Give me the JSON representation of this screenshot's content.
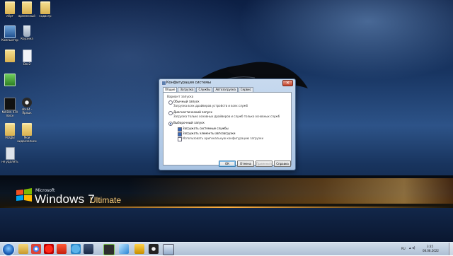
{
  "colors": {
    "accent": "#1a5db5",
    "dialog_frame": "#a9c3e2",
    "close_red": "#c5432a",
    "band_orange": "#ffb040"
  },
  "wallpaper": {
    "brand_small": "Microsoft",
    "brand_main": "Windows 7",
    "brand_edition": "Ultimate"
  },
  "desktop_icons": [
    {
      "label": "лёрт",
      "icon": "folder"
    },
    {
      "label": "временный",
      "icon": "folder"
    },
    {
      "label": "кадастр",
      "icon": "folder"
    },
    {
      "label": "Компьютер",
      "icon": "pc"
    },
    {
      "label": "Корзина",
      "icon": "trash"
    },
    {
      "label": "",
      "icon": "folder"
    },
    {
      "label": "Doc2",
      "icon": "doc"
    },
    {
      "label": "",
      "icon": "green"
    },
    {
      "label": "NVIDIA RTX Voice",
      "icon": "nv"
    },
    {
      "label": "obs64 - Ярлык",
      "icon": "obs"
    },
    {
      "label": "МОДЫ",
      "icon": "folder"
    },
    {
      "label": "Мои видеозаписи",
      "icon": "folder"
    },
    {
      "label": "не удалять",
      "icon": "blank"
    }
  ],
  "dialog": {
    "title": "Конфигурация системы",
    "close_glyph": "✕",
    "tabs": [
      "Общие",
      "Загрузка",
      "Службы",
      "Автозагрузка",
      "Сервис"
    ],
    "active_tab": "Общие",
    "group_label": "Вариант запуска",
    "options": [
      {
        "label": "Обычный запуск",
        "desc": "Загрузка всех драйверов устройств и всех служб",
        "selected": false
      },
      {
        "label": "Диагностический запуск",
        "desc": "Загрузка только основных драйверов и служб только основных служб",
        "selected": false
      },
      {
        "label": "Выборочный запуск",
        "desc": "",
        "selected": true
      }
    ],
    "checkboxes": [
      {
        "label": "Загружать системные службы",
        "checked": true
      },
      {
        "label": "Загружать элементы автозагрузки",
        "checked": true
      },
      {
        "label": "Использовать оригинальную конфигурацию загрузки",
        "checked": false
      }
    ],
    "buttons": {
      "ok": "ОК",
      "cancel": "Отмена",
      "apply": "Применить",
      "help": "Справка"
    }
  },
  "taskbar": {
    "pinned": [
      "Проводник",
      "Google Chrome",
      "Яндекс",
      "Telegram",
      "NVIDIA",
      "Steam",
      "Игра",
      "OBS",
      "Окно"
    ],
    "lang": "RU",
    "time": "3:35",
    "date": "08.08.2022"
  }
}
